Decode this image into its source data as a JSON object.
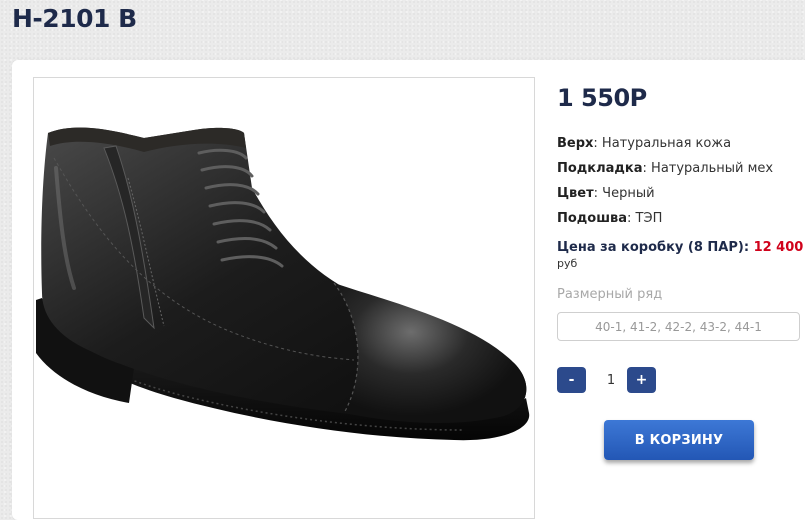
{
  "product": {
    "title": "Н-2101 В",
    "price": "1 550Р",
    "specs": [
      {
        "label": "Верх",
        "value": ": Натуральная кожа"
      },
      {
        "label": "Подкладка",
        "value": ": Натуральный мех"
      },
      {
        "label": "Цвет",
        "value": ": Черный"
      },
      {
        "label": "Подошва",
        "value": ": ТЭП"
      }
    ],
    "box_price_label": "Цена за коробку (8 ПАР): ",
    "box_price_value": "12 400",
    "box_price_unit": "руб",
    "size_label": "Размерный ряд",
    "size_range": "40-1, 41-2, 42-2, 43-2, 44-1"
  },
  "cart": {
    "minus": "-",
    "quantity": "1",
    "plus": "+",
    "add_label": "В КОРЗИНУ"
  },
  "colors": {
    "title": "#1e2a4a",
    "accent": "#2c4a8c",
    "cart_button": "#2f63c4",
    "box_price": "#d0021b"
  }
}
